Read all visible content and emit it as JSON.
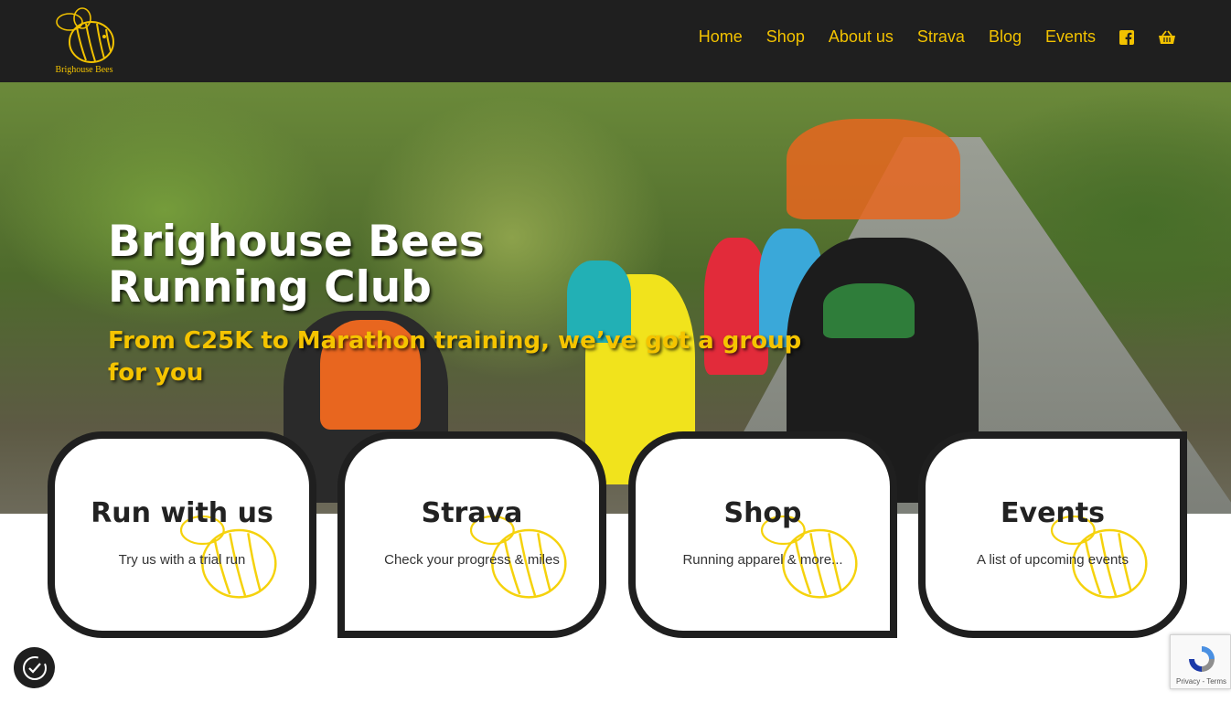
{
  "brand": {
    "logo_text": "Brighouse Bees",
    "accent_color": "#f2c200",
    "header_bg": "#1f1f1f"
  },
  "nav": {
    "items": [
      {
        "label": "Home"
      },
      {
        "label": "Shop"
      },
      {
        "label": "About us"
      },
      {
        "label": "Strava"
      },
      {
        "label": "Blog"
      },
      {
        "label": "Events"
      }
    ],
    "icons": [
      "facebook-icon",
      "basket-icon"
    ]
  },
  "hero": {
    "title": "Brighouse Bees Running Club",
    "subtitle": "From C25K to Marathon training, we’ve got a group for you"
  },
  "cards": [
    {
      "title": "Run with us",
      "description": "Try us with a trial run"
    },
    {
      "title": "Strava",
      "description": "Check your progress & miles"
    },
    {
      "title": "Shop",
      "description": "Running apparel & more..."
    },
    {
      "title": "Events",
      "description": "A list of upcoming events"
    }
  ],
  "recaptcha": {
    "links": "Privacy - Terms"
  },
  "widgets": {
    "consent_icon": "cookie-consent-icon",
    "recaptcha_icon": "recaptcha-icon"
  }
}
